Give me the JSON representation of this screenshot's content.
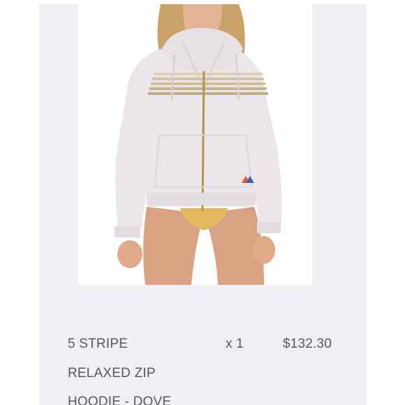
{
  "product": {
    "name_lines": [
      "5 STRIPE",
      "RELAXED ZIP",
      "HOODIE - DOVE"
    ],
    "quantity": "x 1",
    "price": "$132.30",
    "image": "hoodie-photo"
  },
  "colors": {
    "page_bg": "#ffffff",
    "card_bg": "#eff0f4",
    "text": "#58585e",
    "hoodie": "#ebe6ea",
    "stripe": "#cfbf9c"
  }
}
